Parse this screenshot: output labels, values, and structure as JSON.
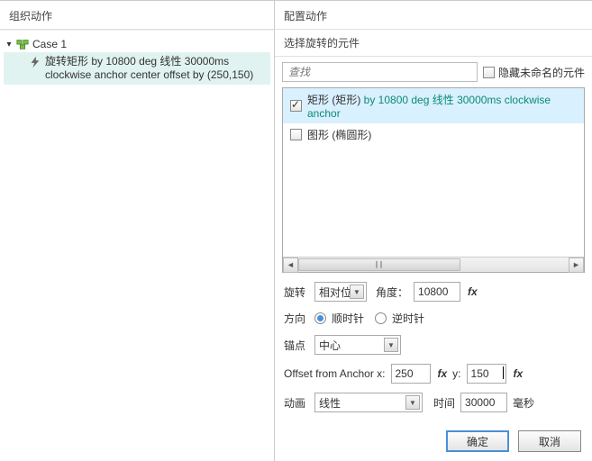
{
  "left": {
    "title": "组织动作",
    "case_label": "Case 1",
    "action_prefix": "旋转",
    "action_target": "矩形",
    "action_rest": " by 10800 deg 线性 30000ms clockwise anchor center offset by (250,150)"
  },
  "right": {
    "title": "配置动作",
    "select_widget_label": "选择旋转的元件",
    "search_placeholder": "查找",
    "hide_unnamed_label": "隐藏未命名的元件",
    "items": [
      {
        "checked": true,
        "label": "矩形 (矩形)",
        "suffix": " by 10800 deg 线性 30000ms clockwise anchor"
      },
      {
        "checked": false,
        "label": "图形 (椭圆形)",
        "suffix": ""
      }
    ],
    "rotate_label": "旋转",
    "rotate_mode": "相对位",
    "angle_label": "角度：",
    "angle_value": "10800",
    "fx": "fx",
    "direction_label": "方向",
    "cw_label": "顺时针",
    "ccw_label": "逆时针",
    "anchor_label": "锚点",
    "anchor_value": "中心",
    "offset_label": "Offset from Anchor  x:",
    "offset_x": "250",
    "y_label": "y:",
    "offset_y": "150",
    "anim_label": "动画",
    "anim_value": "线性",
    "time_label": "时间",
    "time_value": "30000",
    "ms_label": "毫秒",
    "ok": "确定",
    "cancel": "取消"
  }
}
